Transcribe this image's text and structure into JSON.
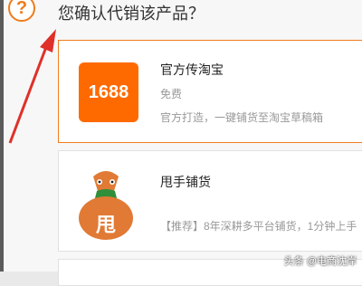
{
  "dialog": {
    "title": "您确认代销该产品？",
    "help_glyph": "?"
  },
  "options": [
    {
      "logo_text": "1688",
      "name": "官方传淘宝",
      "price": "免费",
      "desc": "官方打造，一键铺货至淘宝草稿箱",
      "selected": true
    },
    {
      "logo_text": "甩",
      "name": "甩手铺货",
      "desc": "【推荐】8年深耕多平台铺货，1分钟上手"
    }
  ],
  "watermark": "头条 @电商沈岸",
  "colors": {
    "accent": "#f07c1d",
    "logo_bg": "#ff6a00",
    "bag": "#e07a35",
    "arrow": "#e0302a"
  },
  "icons": [
    "help-icon",
    "annotation-arrow",
    "1688-logo",
    "money-bag-logo"
  ]
}
